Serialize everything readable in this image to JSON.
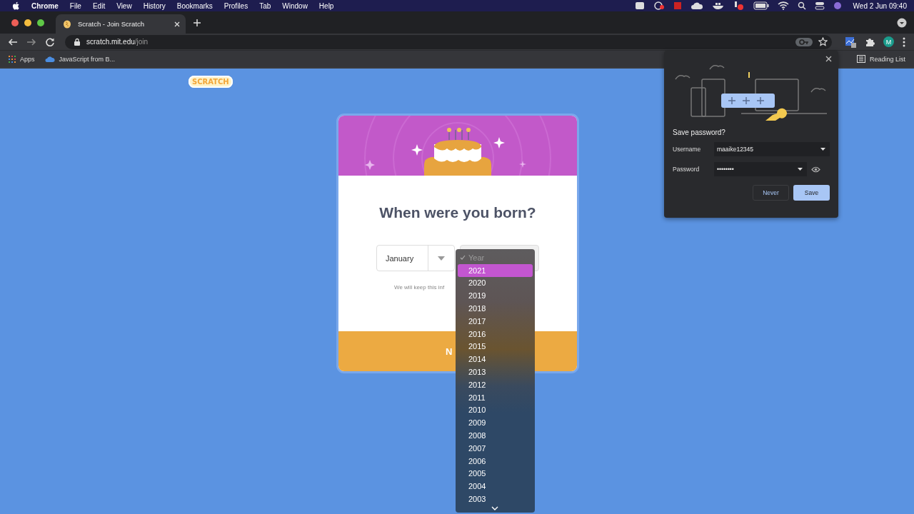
{
  "menu_bar": {
    "app": "Chrome",
    "items": [
      "File",
      "Edit",
      "View",
      "History",
      "Bookmarks",
      "Profiles",
      "Tab",
      "Window",
      "Help"
    ],
    "clock": "Wed 2 Jun  09:40"
  },
  "tabs": [
    {
      "title": "Scratch - Join Scratch",
      "selected": true
    }
  ],
  "address_bar": {
    "host": "scratch.mit.edu",
    "path": "/join"
  },
  "bookmarks": [
    "Apps",
    "JavaScript from B..."
  ],
  "reading_list": "Reading List",
  "profile_initial": "M",
  "page": {
    "logo": "SCRATCH",
    "title": "When were you born?",
    "month": "January",
    "note": "We will keep this inf",
    "next_button": "N"
  },
  "year_menu": {
    "items": [
      {
        "label": "Year",
        "checked": true,
        "selected": false
      },
      {
        "label": "2021",
        "checked": false,
        "selected": true
      },
      {
        "label": "2020",
        "checked": false,
        "selected": false
      },
      {
        "label": "2019",
        "checked": false,
        "selected": false
      },
      {
        "label": "2018",
        "checked": false,
        "selected": false
      },
      {
        "label": "2017",
        "checked": false,
        "selected": false
      },
      {
        "label": "2016",
        "checked": false,
        "selected": false
      },
      {
        "label": "2015",
        "checked": false,
        "selected": false
      },
      {
        "label": "2014",
        "checked": false,
        "selected": false
      },
      {
        "label": "2013",
        "checked": false,
        "selected": false
      },
      {
        "label": "2012",
        "checked": false,
        "selected": false
      },
      {
        "label": "2011",
        "checked": false,
        "selected": false
      },
      {
        "label": "2010",
        "checked": false,
        "selected": false
      },
      {
        "label": "2009",
        "checked": false,
        "selected": false
      },
      {
        "label": "2008",
        "checked": false,
        "selected": false
      },
      {
        "label": "2007",
        "checked": false,
        "selected": false
      },
      {
        "label": "2006",
        "checked": false,
        "selected": false
      },
      {
        "label": "2005",
        "checked": false,
        "selected": false
      },
      {
        "label": "2004",
        "checked": false,
        "selected": false
      },
      {
        "label": "2003",
        "checked": false,
        "selected": false
      }
    ]
  },
  "password_popup": {
    "title": "Save password?",
    "username_label": "Username",
    "username": "maaike12345",
    "password_label": "Password",
    "password": "••••••••",
    "buttons": [
      "Never",
      "Save"
    ]
  }
}
